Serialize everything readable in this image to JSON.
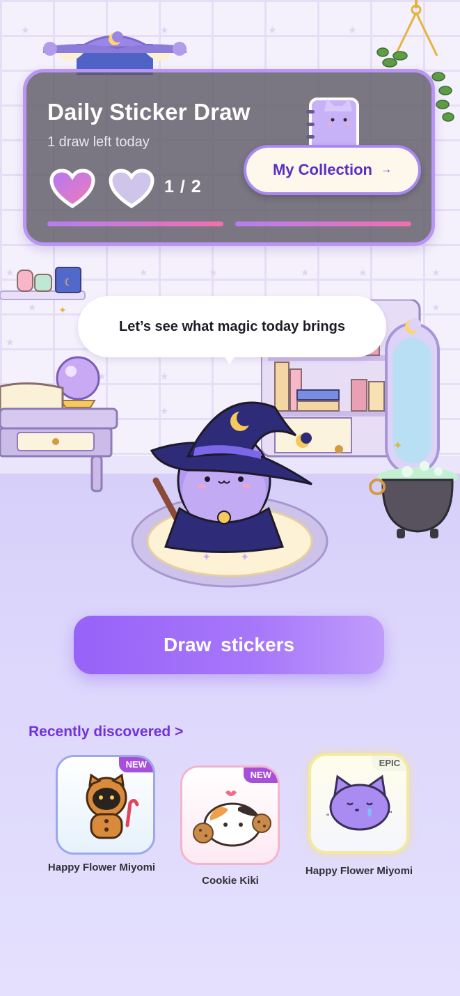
{
  "header": {
    "title": "Daily Sticker Draw",
    "subtitle": "1 draw left today",
    "draw_count": "1 / 2",
    "hearts_filled": 1,
    "hearts_total": 2,
    "collection_button": "My Collection",
    "collection_arrow": "→"
  },
  "speech": {
    "text": "Let’s see what magic today brings"
  },
  "draw_button": {
    "label": "Draw stickers"
  },
  "recent": {
    "link": "Recently discovered >",
    "items": [
      {
        "name": "Happy Flower Miyomi",
        "badge": "NEW",
        "art": "gingerbread-cat-sticker"
      },
      {
        "name": "Cookie Kiki",
        "badge": "NEW",
        "art": "calico-cookie-cat-sticker"
      },
      {
        "name": "Happy Flower Miyomi",
        "badge": "EPIC",
        "art": "crying-purple-cat-sticker"
      }
    ]
  },
  "colors": {
    "accent": "#9662f8",
    "link": "#7133d8",
    "new_badge": "#a84fd9",
    "floor": "#dcd6fb"
  }
}
